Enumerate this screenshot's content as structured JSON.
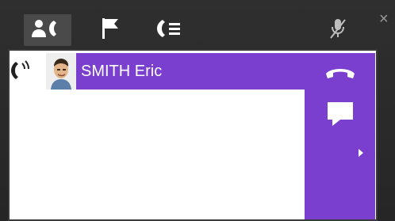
{
  "window": {
    "toolbar": {
      "tabs": [
        {
          "icon": "contacts-phone-icon",
          "active": true
        },
        {
          "icon": "flag-icon",
          "active": false
        },
        {
          "icon": "call-list-icon",
          "active": false
        }
      ],
      "right_icon": "mic-muted-icon",
      "close_label": "×"
    },
    "call": {
      "contact_name": "SMITH Eric",
      "actions": [
        "hang-up-icon",
        "chat-icon",
        "more-arrow-icon"
      ],
      "accent": "#7b3fcf"
    }
  }
}
